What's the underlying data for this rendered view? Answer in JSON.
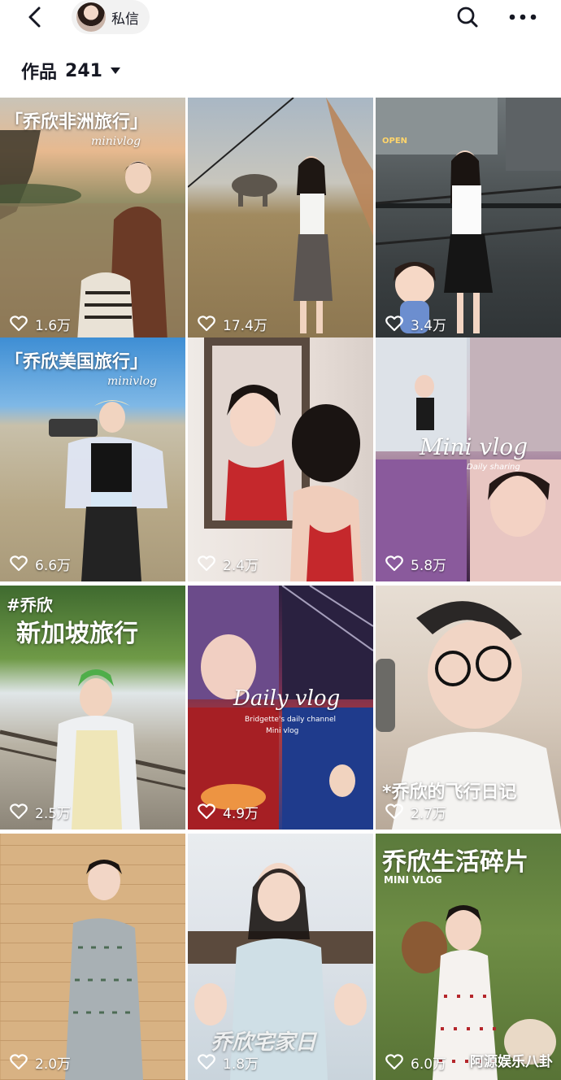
{
  "header": {
    "chip_label": "私信"
  },
  "works": {
    "label": "作品",
    "count": "241"
  },
  "tiles": [
    {
      "likes": "1.6万",
      "caption": "「乔欣非洲旅行」",
      "subtitle": "minivlog"
    },
    {
      "likes": "17.4万",
      "caption": "",
      "subtitle": ""
    },
    {
      "likes": "3.4万",
      "caption": "",
      "subtitle": "",
      "sign": "OPEN"
    },
    {
      "likes": "6.6万",
      "caption": "「乔欣美国旅行」",
      "subtitle": "minivlog"
    },
    {
      "likes": "2.4万",
      "caption": "",
      "subtitle": ""
    },
    {
      "likes": "5.8万",
      "caption": "",
      "subtitle": "Mini vlog",
      "small": "Daily sharing"
    },
    {
      "likes": "2.5万",
      "caption": "新加坡旅行",
      "subtitle": "",
      "tag": "#乔欣"
    },
    {
      "likes": "4.9万",
      "caption": "",
      "subtitle": "Daily vlog",
      "small": "Bridgette's daily channel",
      "small2": "Mini vlog"
    },
    {
      "likes": "2.7万",
      "caption": "*乔欣的飞行日记",
      "subtitle": ""
    },
    {
      "likes": "2.0万",
      "caption": "",
      "subtitle": ""
    },
    {
      "likes": "1.8万",
      "caption": "乔欣宅家日",
      "subtitle": ""
    },
    {
      "likes": "6.0万",
      "caption": "乔欣生活碎片",
      "subtitle": "MINI VLOG"
    }
  ],
  "watermark": "阿源娱乐八卦",
  "colors": {
    "text": "#161823",
    "chip_bg": "#f2f2f2",
    "caption_yellow": "#f6c445"
  },
  "icons": [
    "back-arrow-icon",
    "search-icon",
    "more-icon",
    "caret-down-icon",
    "heart-icon"
  ]
}
